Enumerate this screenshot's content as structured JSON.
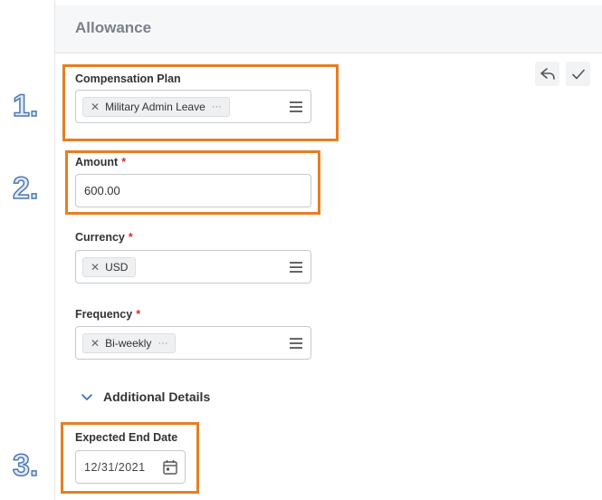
{
  "panel": {
    "title": "Allowance"
  },
  "steps": [
    "1.",
    "2.",
    "3."
  ],
  "actions": {
    "undo_icon": "undo-icon",
    "confirm_icon": "check-icon"
  },
  "fields": {
    "compensation_plan": {
      "label": "Compensation Plan",
      "value": "Military Admin Leave",
      "more": "···"
    },
    "amount": {
      "label": "Amount",
      "required_marker": "*",
      "value": "600.00"
    },
    "currency": {
      "label": "Currency",
      "required_marker": "*",
      "value": "USD"
    },
    "frequency": {
      "label": "Frequency",
      "required_marker": "*",
      "value": "Bi-weekly",
      "more": "···"
    },
    "expected_end_date": {
      "label": "Expected End Date",
      "value": "12/31/2021"
    }
  },
  "section": {
    "label": "Additional Details"
  },
  "colors": {
    "highlight": "#e67e22",
    "required": "#de2b2b",
    "step_number": "#4a79b4"
  }
}
